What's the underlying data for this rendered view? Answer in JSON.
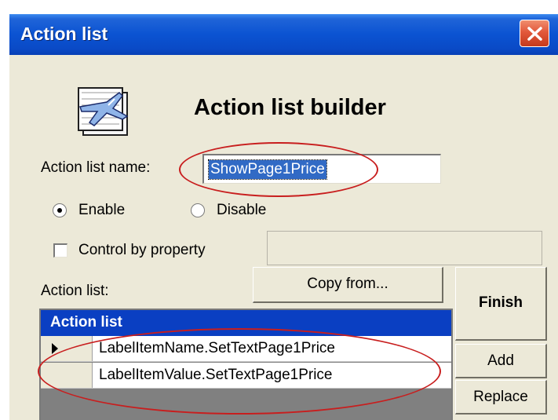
{
  "window": {
    "title": "Action list",
    "close_icon": "close-icon"
  },
  "header": {
    "icon": "action-list-builder-icon",
    "heading": "Action list builder"
  },
  "form": {
    "name_label": "Action list name:",
    "name_value": "ShowPage1Price",
    "enable_label": "Enable",
    "enable_checked": true,
    "disable_label": "Disable",
    "disable_checked": false,
    "control_by_property_label": "Control by property",
    "control_by_property_checked": false,
    "property_value": ""
  },
  "action_list": {
    "label": "Action list:",
    "column_header": "Action list",
    "rows": [
      {
        "value": "LabelItemName.SetTextPage1Price",
        "current": true
      },
      {
        "value": "LabelItemValue.SetTextPage1Price",
        "current": false
      }
    ]
  },
  "buttons": {
    "copy_from": "Copy from...",
    "finish": "Finish",
    "add": "Add",
    "replace": "Replace"
  },
  "colors": {
    "titlebar": "#0b53d2",
    "close_button": "#e2583b",
    "dialog_face": "#ece9d8",
    "selection": "#316ac5",
    "grid_header": "#0a3fc2",
    "annotation_ellipse": "#c81e1e"
  }
}
